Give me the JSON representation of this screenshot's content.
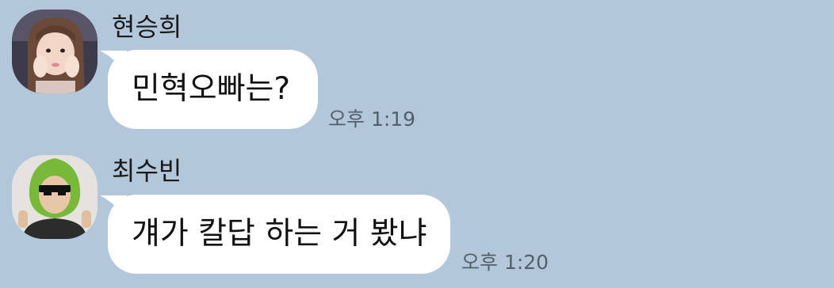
{
  "colors": {
    "background": "#b2c7da",
    "bubble": "#ffffff",
    "timestamp": "#53606c"
  },
  "messages": [
    {
      "sender": "현승희",
      "text": "민혁오빠는?",
      "time": "오후 1:19",
      "avatar_icon": "profile-photo-girl"
    },
    {
      "sender": "최수빈",
      "text": "걔가 칼답 하는 거 봤냐",
      "time": "오후 1:20",
      "avatar_icon": "profile-photo-avocado-costume"
    }
  ]
}
